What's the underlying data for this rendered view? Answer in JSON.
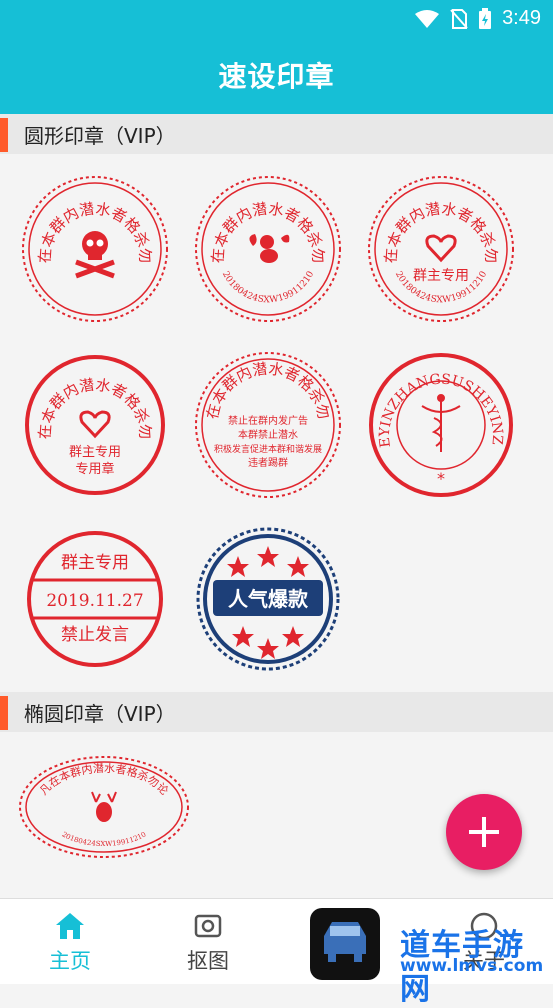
{
  "status": {
    "time": "3:49"
  },
  "app": {
    "title": "速设印章"
  },
  "sections": [
    {
      "title": "圆形印章（VIP）"
    },
    {
      "title": "椭圆印章（VIP）"
    }
  ],
  "stamps": {
    "arc_text": "凡在本群内潜水者格杀勿论",
    "code": "20180424SXW19911210",
    "group_owner": "群主专用",
    "group_owner_seal": "专用章",
    "notice_lines": [
      "禁止在群内发广告",
      "本群禁止潜水",
      "积极发言促进本群和谐发展",
      "违者踢群"
    ],
    "english_ring": "SUSHEYINZHANGSUSHEYINZHANG",
    "date": "2019.11.27",
    "no_speech": "禁止发言",
    "popular": "人气爆款"
  },
  "bottom_nav": [
    {
      "label": "主页"
    },
    {
      "label": "抠图"
    },
    {
      "label": "关于"
    }
  ],
  "watermark": {
    "text": "道车手游网",
    "url": "www.lmvs.com"
  },
  "colors": {
    "primary": "#16bfd6",
    "accent": "#e81e63",
    "stamp_red": "#e0262e",
    "navy": "#1d3f78",
    "section_bar": "#ff5a2a",
    "nav_active": "#16bfd6"
  }
}
